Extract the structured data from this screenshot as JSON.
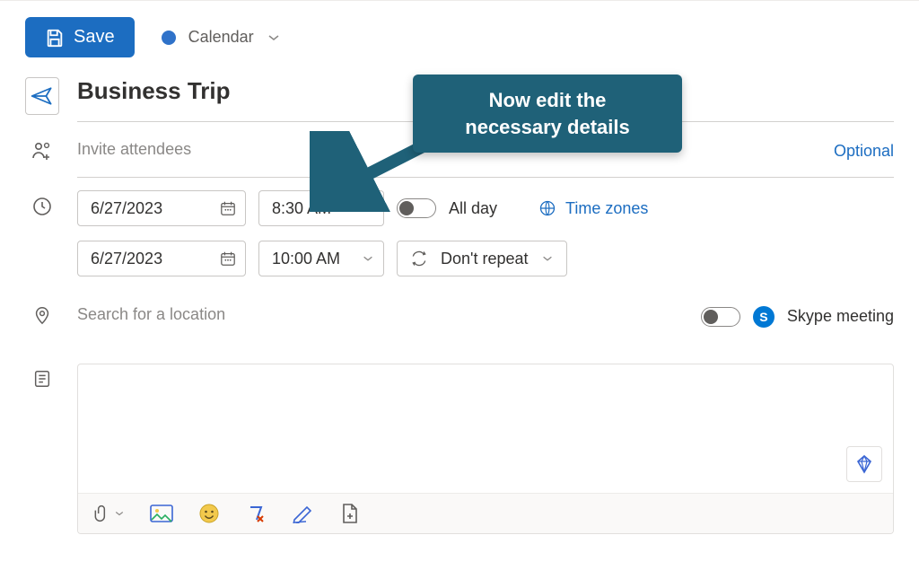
{
  "toolbar": {
    "save_label": "Save",
    "calendar_label": "Calendar"
  },
  "event": {
    "title": "Business Trip",
    "attendees_placeholder": "Invite attendees",
    "optional_link": "Optional",
    "start_date": "6/27/2023",
    "start_time": "8:30 AM",
    "end_date": "6/27/2023",
    "end_time": "10:00 AM",
    "all_day_label": "All day",
    "time_zones_label": "Time zones",
    "repeat_label": "Don't repeat",
    "location_placeholder": "Search for a location",
    "skype_label": "Skype meeting"
  },
  "callout": {
    "line1": "Now edit the",
    "line2": "necessary details"
  },
  "colors": {
    "accent": "#1c6dc1",
    "callout_bg": "#1f6178"
  }
}
